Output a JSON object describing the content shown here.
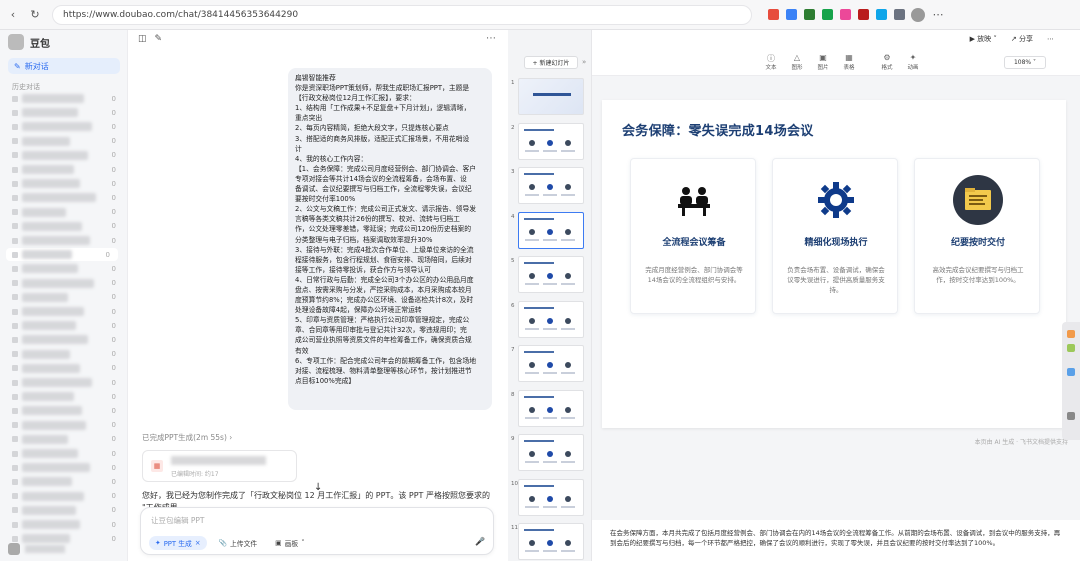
{
  "browser": {
    "url": "https://www.doubao.com/chat/38414456353644290",
    "back_icon": "chevron-left-icon",
    "reload_icon": "reload-icon",
    "extension_colors": [
      "#e74c3c",
      "#3b82f6",
      "#2e7d32",
      "#16a34a",
      "#ec4899",
      "#b91c1c",
      "#0ea5e9",
      "#6b7280"
    ]
  },
  "sidebar": {
    "brand": "豆包",
    "new_chat": "新对话",
    "history_label": "历史对话",
    "items": [
      {
        "count": "0"
      },
      {
        "count": "0"
      },
      {
        "count": "0"
      },
      {
        "count": "0"
      },
      {
        "count": "0"
      },
      {
        "count": "0"
      },
      {
        "count": "0"
      },
      {
        "count": "0"
      },
      {
        "count": "0"
      },
      {
        "count": "0"
      },
      {
        "count": "0"
      },
      {
        "count": "0"
      },
      {
        "count": "0"
      },
      {
        "count": "0"
      },
      {
        "count": "0"
      },
      {
        "count": "0"
      },
      {
        "count": "0"
      },
      {
        "count": "0"
      },
      {
        "count": "0"
      },
      {
        "count": "0"
      },
      {
        "count": "0"
      },
      {
        "count": "0"
      },
      {
        "count": "0"
      },
      {
        "count": "0"
      },
      {
        "count": "0"
      },
      {
        "count": "0"
      },
      {
        "count": "0"
      },
      {
        "count": "0"
      },
      {
        "count": "0"
      },
      {
        "count": "0"
      },
      {
        "count": "0"
      },
      {
        "count": "0"
      }
    ]
  },
  "chat": {
    "prompt_lines": [
      "扁锡智能推荐",
      "你是资深职场PPT策划师，帮我生成职场汇报PPT，主题是",
      "【行政文秘岗位12月工作汇报】，要求：",
      "1、结构用「工作成果+不足复盘+下月计划」，逻辑清晰，",
      "重点突出",
      "2、每页内容精简，拒绝大段文字，只提炼核心要点",
      "3、搭配适的商务风排版，适配正式汇报场景，不用花哨设",
      "计",
      "4、我的核心工作内容：",
      "【1、会务保障：完成公司月度经营例会、部门协调会、客户",
      "专项对接会等共计14场会议的全流程筹备，会场布置、设",
      "备调试、会议纪要撰写与归档工作，全流程零失误，会议纪",
      "要按时交付率100%",
      "2、公文与文稿工作：完成公司正式发文、请示报告、领导发",
      "言稿等各类文稿共计26份的撰写、校对、流转与归档工",
      "作，公文处理零差错，零延误；完成公司120份历史档案的",
      "分类整理与电子归档，档案调取效率提升30%",
      "3、接待与外联：完成4批次合作单位、上级单位来访的全流",
      "程接待服务，包含行程规划、食宿安排、现场陪同，后续对",
      "接等工作，接待零投诉，获合作方与领导认可",
      "4、日常行政与后勤：完成全公司3个办公区的办公用品月度",
      "盘点、按需采购与分发，严控采购成本，本月采购成本较月",
      "度预算节约8%；完成办公区环境、设备巡检共计8次，及时",
      "处理设备故障4起，保障办公环境正常运转",
      "5、印章与资质管理：严格执行公司印章管理规定，完成公",
      "章、合同章等用印审批与登记共计32次，零违规用印；完",
      "成公司营业执照等资质文件的年检筹备工作，确保资质合规",
      "有效",
      "6、专项工作：配合完成公司年会的前期筹备工作，包含场地",
      "对接、流程梳理、物料清单整理等核心环节，按计划推进节",
      "点目标100%完成】"
    ],
    "done_status": "已完成PPT生成(2m 55s)",
    "ppt_card_sub": "已编辑时间: 约17",
    "answer_text": "您好，我已经为您制作完成了「行政文秘岗位 12 月工作汇报」的 PPT。该 PPT 严格按照您要求的 \"工作成果",
    "composer_placeholder": "让豆包编辑 PPT",
    "tool_ppt": "PPT 生成",
    "tool_upload": "上传文件",
    "tool_canvas": "画板"
  },
  "thumbs": {
    "new_slide": "+ 新建幻灯片",
    "numbers": [
      "1",
      "2",
      "3",
      "4",
      "5",
      "6",
      "7",
      "8",
      "9",
      "10",
      "11"
    ],
    "selected": "4"
  },
  "editor": {
    "top_right": {
      "play": "放映",
      "share": "分享"
    },
    "toolbar": [
      "文本",
      "图形",
      "图片",
      "表格",
      "格式",
      "动画"
    ],
    "zoom": "108%",
    "slide_title": "会务保障：零失误完成14场会议",
    "cards": [
      {
        "icon": "meeting-icon",
        "title": "全流程会议筹备",
        "desc": "完成月度经营例会、部门协调会等14场会议的全流程组织与安排。"
      },
      {
        "icon": "gear-icon",
        "title": "精细化现场执行",
        "desc": "负责会场布置、设备调试，确保会议零失误进行，提供高质量服务支持。"
      },
      {
        "icon": "document-folder-icon",
        "title": "纪要按时交付",
        "desc": "高效完成会议纪要撰写与归档工作，按时交付率达到100%。"
      }
    ],
    "watermark": "本页由 AI 生成 · 飞书文档提供支持",
    "notes": "在会务保障方面，本月共完成了包括月度经营例会、部门协调会在内的14场会议的全流程筹备工作。从前期的会场布置、设备调试，到会议中的服务支持，再到会后的纪要撰写与归档，每一个环节都严格把控，确保了会议的顺利进行，实现了零失误，并且会议纪要的按时交付率达到了100%。",
    "brand_color": "#1d3f73"
  }
}
